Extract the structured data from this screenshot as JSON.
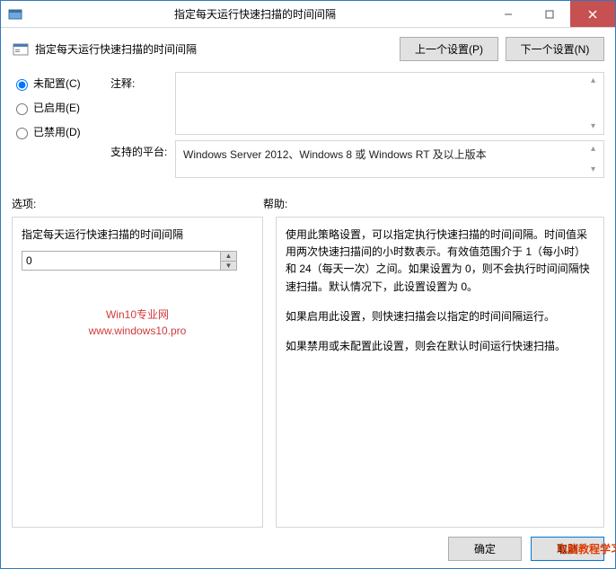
{
  "window": {
    "title": "指定每天运行快速扫描的时间间隔"
  },
  "header": {
    "subtitle": "指定每天运行快速扫描的时间间隔",
    "prev_btn": "上一个设置(P)",
    "next_btn": "下一个设置(N)"
  },
  "radios": {
    "not_configured": "未配置(C)",
    "enabled": "已启用(E)",
    "disabled": "已禁用(D)"
  },
  "info": {
    "comment_label": "注释:",
    "platform_label": "支持的平台:",
    "platform_text": "Windows Server 2012、Windows 8 或 Windows RT 及以上版本"
  },
  "mid": {
    "options_label": "选项:",
    "help_label": "帮助:"
  },
  "options_panel": {
    "field_label": "指定每天运行快速扫描的时间间隔",
    "value": "0"
  },
  "watermark": {
    "line1": "Win10专业网",
    "line2": "www.windows10.pro"
  },
  "help_panel": {
    "p1": "使用此策略设置，可以指定执行快速扫描的时间间隔。时间值采用两次快速扫描间的小时数表示。有效值范围介于 1（每小时）和 24（每天一次）之间。如果设置为 0，则不会执行时间间隔快速扫描。默认情况下，此设置设置为 0。",
    "p2": "如果启用此设置，则快速扫描会以指定的时间间隔运行。",
    "p3": "如果禁用或未配置此设置，则会在默认时间运行快速扫描。"
  },
  "footer": {
    "ok": "确定",
    "cancel": "取消",
    "overlay": "电脑教程学习网"
  }
}
